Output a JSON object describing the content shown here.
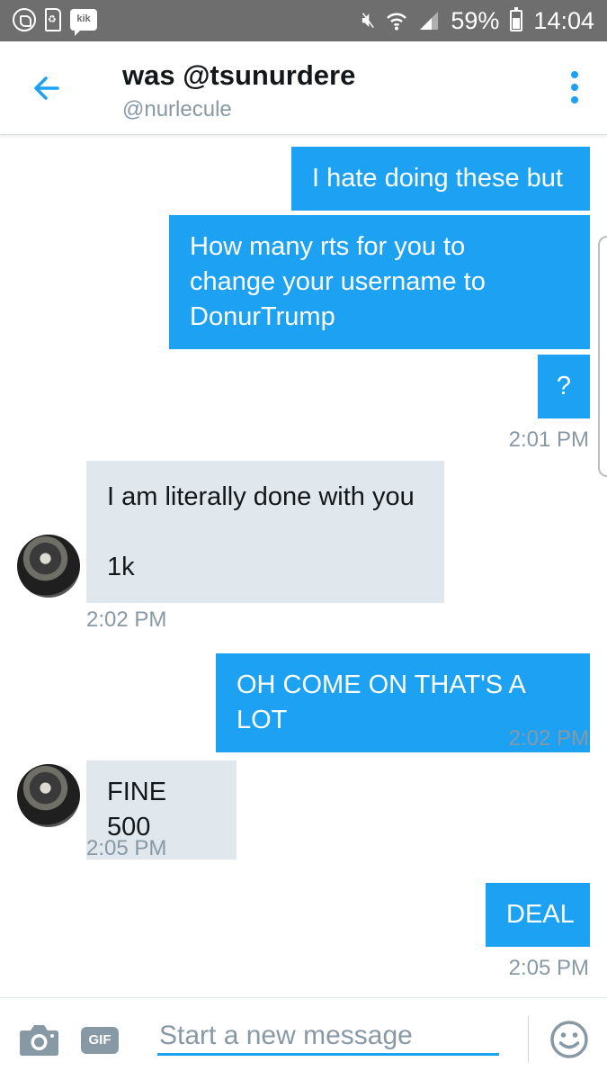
{
  "status_bar": {
    "battery_percent": "59%",
    "time": "14:04",
    "icons": [
      "whatsapp-icon",
      "sdcard-icon",
      "kik-icon",
      "mute-icon",
      "wifi-icon",
      "signal-icon",
      "battery-icon"
    ],
    "kik_label": "kik"
  },
  "header": {
    "title": "was @tsunurdere",
    "handle": "@nurlecule",
    "back_icon": "back-arrow-icon",
    "more_icon": "more-vertical-icon"
  },
  "messages": [
    {
      "direction": "out",
      "text": "I hate doing these but"
    },
    {
      "direction": "out",
      "text": "How many rts for you to\nchange your username to\nDonurTrump"
    },
    {
      "direction": "out",
      "text": "?"
    },
    {
      "direction": "out",
      "timestamp": "2:01 PM"
    },
    {
      "direction": "in",
      "text": "I am literally done with you\n\n1k"
    },
    {
      "direction": "in",
      "timestamp": "2:02 PM"
    },
    {
      "direction": "out",
      "text": "OH COME ON THAT'S A LOT"
    },
    {
      "direction": "out",
      "timestamp": "2:02 PM"
    },
    {
      "direction": "in",
      "text": "FINE 500"
    },
    {
      "direction": "in",
      "timestamp": "2:05 PM"
    },
    {
      "direction": "out",
      "text": "DEAL"
    },
    {
      "direction": "out",
      "timestamp": "2:05 PM"
    }
  ],
  "composer": {
    "placeholder": "Start a new message",
    "gif_label": "GIF",
    "camera_icon": "camera-icon",
    "emoji_icon": "emoji-icon"
  },
  "colors": {
    "accent": "#1da1f2",
    "incoming_bubble": "#e1e8ed",
    "status_bar": "#6e6e6e",
    "muted_text": "#8899a6"
  }
}
